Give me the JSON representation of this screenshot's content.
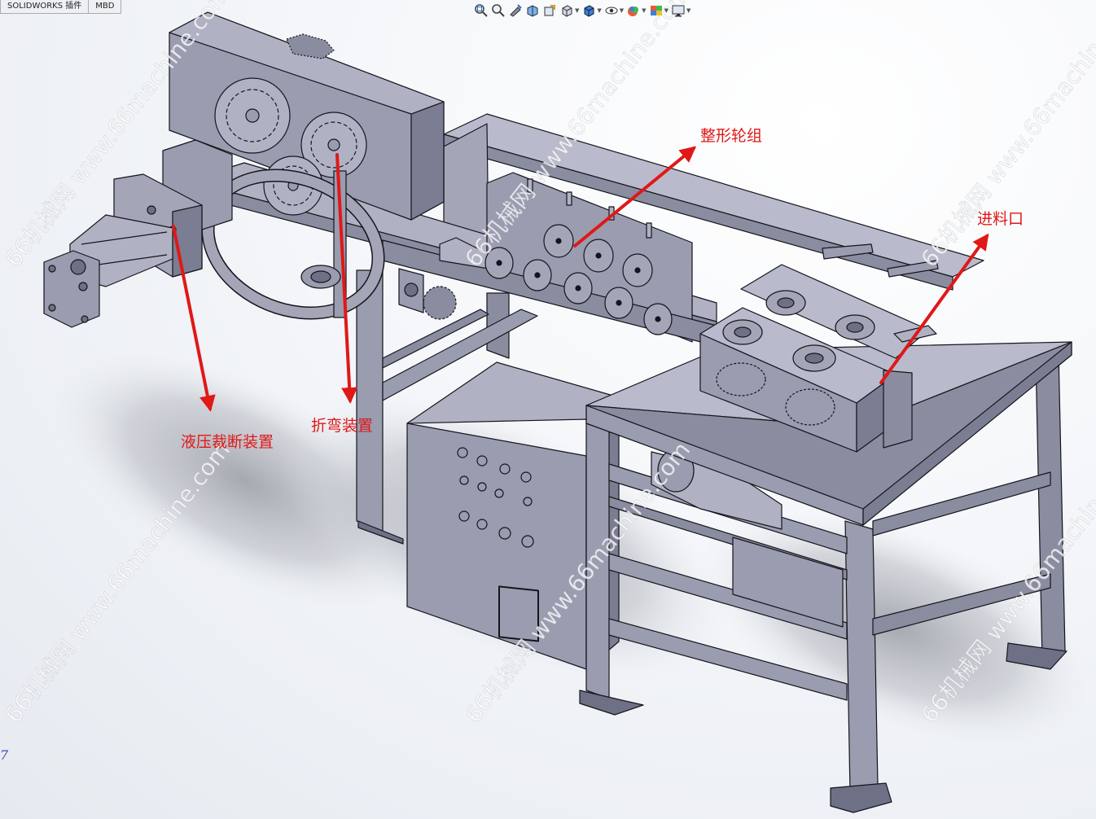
{
  "tabs": [
    {
      "label": "SOLIDWORKS 插件"
    },
    {
      "label": "MBD"
    }
  ],
  "hud_toolbar": [
    {
      "icon": "zoom-to-fit-icon"
    },
    {
      "icon": "zoom-to-area-icon"
    },
    {
      "icon": "previous-view-icon"
    },
    {
      "icon": "section-view-icon"
    },
    {
      "icon": "dynamic-annotation-icon"
    },
    {
      "icon": "view-orientation-icon",
      "has_dropdown": true
    },
    {
      "icon": "display-style-icon",
      "has_dropdown": true
    },
    {
      "icon": "hide-show-items-icon",
      "has_dropdown": true
    },
    {
      "icon": "edit-appearance-icon",
      "has_dropdown": true
    },
    {
      "icon": "apply-scene-icon",
      "has_dropdown": true
    },
    {
      "icon": "view-settings-icon",
      "has_dropdown": true
    }
  ],
  "annotations": [
    {
      "label": "整形轮组"
    },
    {
      "label": "进料口"
    },
    {
      "label": "液压裁断装置"
    },
    {
      "label": "折弯装置"
    }
  ],
  "watermark": {
    "text": "66机械网 www.66machine.com"
  },
  "colors": {
    "part_fill": "#9a9cb0",
    "part_light": "#b9bbcc",
    "part_dark": "#6e7085",
    "edge": "#15151c",
    "annotation": "#e01818",
    "watermark": "#ffffff",
    "triad": "#3a4cc4"
  }
}
